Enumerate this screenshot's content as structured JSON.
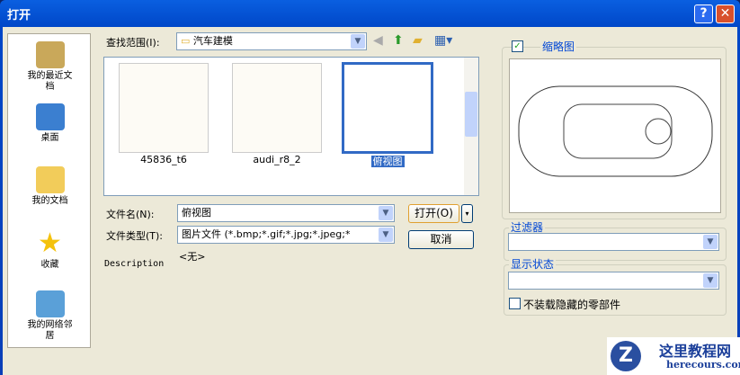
{
  "window": {
    "title": "打开",
    "help": "?",
    "close": "✕"
  },
  "places": [
    {
      "label": "我的最近文档"
    },
    {
      "label": "桌面"
    },
    {
      "label": "我的文档"
    },
    {
      "label": "收藏"
    },
    {
      "label": "我的网络邻居"
    }
  ],
  "look_in": {
    "label": "查找范围(I):",
    "value": "汽车建模"
  },
  "files": [
    {
      "name": "45836_t6"
    },
    {
      "name": "audi_r8_2"
    },
    {
      "name": "俯视图",
      "selected": true
    }
  ],
  "filename": {
    "label": "文件名(N):",
    "value": "俯视图"
  },
  "filetype": {
    "label": "文件类型(T):",
    "value": "图片文件 (*.bmp;*.gif;*.jpg;*.jpeg;*"
  },
  "buttons": {
    "open": "打开(O)",
    "cancel": "取消"
  },
  "description": {
    "label": "Description",
    "value": "<无>"
  },
  "thumbnail": {
    "label": "缩略图",
    "checked": true
  },
  "filter": {
    "label": "过滤器",
    "value": ""
  },
  "display_state": {
    "label": "显示状态",
    "value": ""
  },
  "no_load_hidden": {
    "label": "不装载隐藏的零部件",
    "checked": false
  },
  "watermark": {
    "title": "这里教程网",
    "url": "herecours.com"
  }
}
